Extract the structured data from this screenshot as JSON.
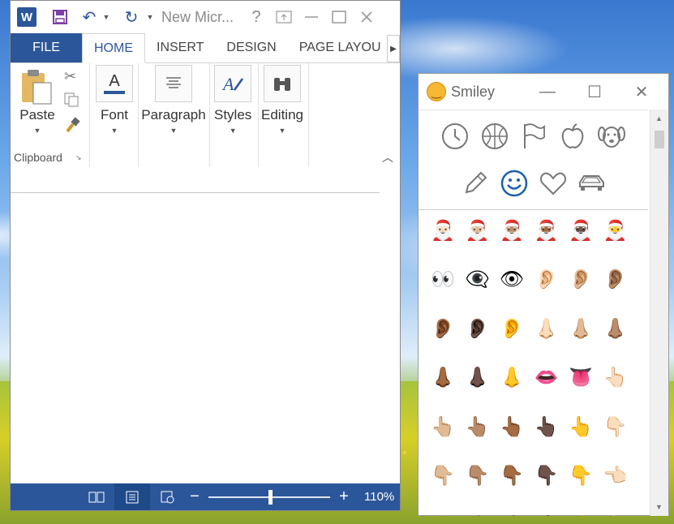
{
  "word": {
    "title": "New Micr...",
    "logo_letter": "W",
    "help_glyph": "?",
    "tabs": [
      "FILE",
      "HOME",
      "INSERT",
      "DESIGN",
      "PAGE LAYOU"
    ],
    "groups": {
      "paste": "Paste",
      "clipboard": "Clipboard",
      "font": "Font",
      "font_icon_letter": "A",
      "paragraph": "Paragraph",
      "styles": "Styles",
      "editing": "Editing"
    },
    "zoom": "110%",
    "accent": "#2b579a"
  },
  "emoji_panel": {
    "title": "Smiley",
    "categories": [
      "clock-icon",
      "basketball-icon",
      "flag-icon",
      "apple-icon",
      "dog-icon",
      "pencil-icon",
      "smiley-icon",
      "heart-icon",
      "car-icon"
    ],
    "selected_category": "smiley-icon",
    "rows": [
      [
        "🎅🏻",
        "🎅🏼",
        "🎅🏽",
        "🎅🏾",
        "🎅🏿",
        "🎅"
      ],
      [
        "👀",
        "👁‍🗨",
        "👁",
        "👂🏻",
        "👂🏼",
        "👂🏽"
      ],
      [
        "👂🏾",
        "👂🏿",
        "👂",
        "👃🏻",
        "👃🏼",
        "👃🏽"
      ],
      [
        "👃🏾",
        "👃🏿",
        "👃",
        "👄",
        "👅",
        "👆🏻"
      ],
      [
        "👆🏼",
        "👆🏽",
        "👆🏾",
        "👆🏿",
        "👆",
        "👇🏻"
      ],
      [
        "👇🏼",
        "👇🏽",
        "👇🏾",
        "👇🏿",
        "👇",
        "👈🏻"
      ],
      [
        "👈🏼",
        "👈🏽",
        "👈🏾",
        "👈🏿",
        "👈",
        "👉🏻"
      ]
    ]
  }
}
